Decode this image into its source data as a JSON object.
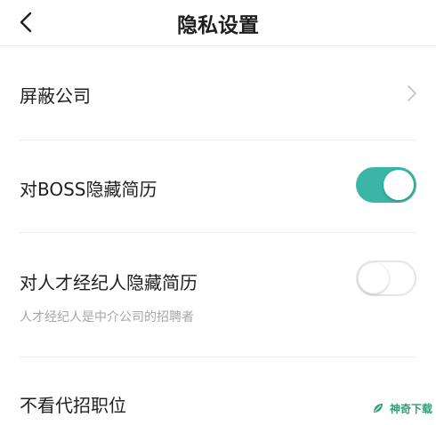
{
  "header": {
    "title": "隐私设置"
  },
  "settings": {
    "block_company": {
      "label": "屏蔽公司"
    },
    "hide_from_boss": {
      "label": "对BOSS隐藏简历",
      "enabled": true
    },
    "hide_from_agent": {
      "label": "对人才经纪人隐藏简历",
      "sublabel": "人才经纪人是中介公司的招聘者",
      "enabled": false
    },
    "no_proxy_jobs": {
      "label": "不看代招职位"
    }
  },
  "watermark": {
    "text": "神奇下载"
  },
  "colors": {
    "accent": "#3bb5a6",
    "text": "#1f1f1f",
    "subtext": "#a6a6a6",
    "divider": "#ececec",
    "watermark": "#2f9e74"
  }
}
